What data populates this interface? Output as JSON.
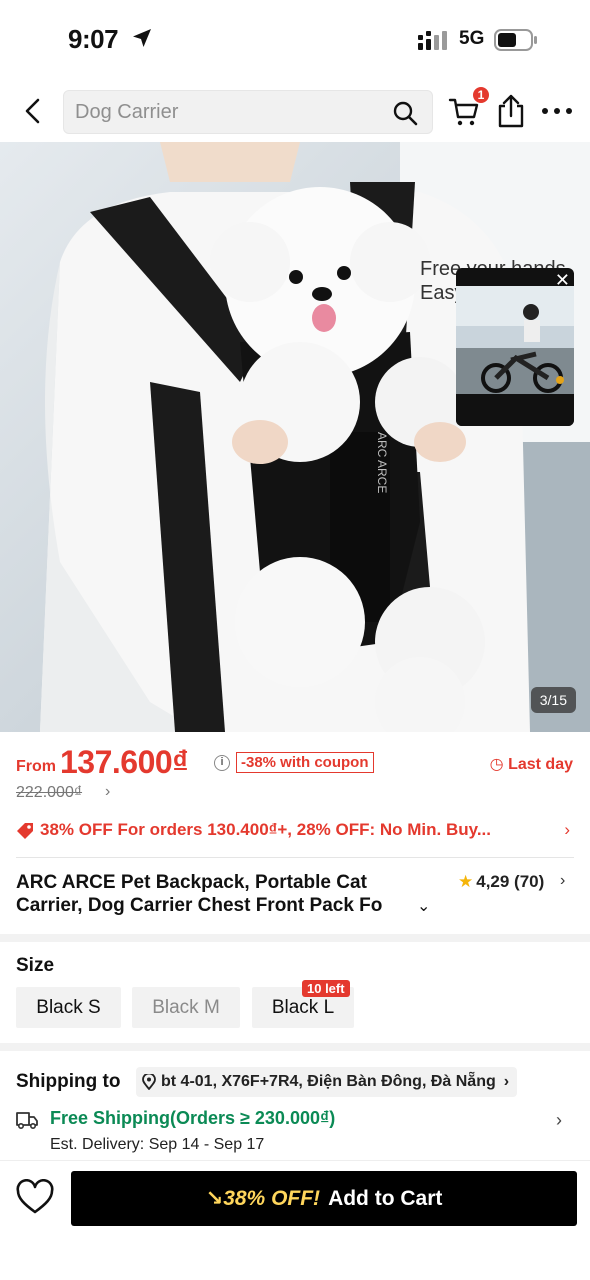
{
  "status_bar": {
    "time": "9:07",
    "network": "5G"
  },
  "header": {
    "search_placeholder": "Dog Carrier",
    "cart_badge": "1"
  },
  "hero": {
    "caption_line1": "Free your hands",
    "caption_line2": "Easy",
    "video_close": "✕",
    "counter": "3/15",
    "bag_brand": "ARC ARCE"
  },
  "price": {
    "from": "From",
    "value": "137.600₫",
    "coupon": "-38% with coupon",
    "last_day": "Last day",
    "original": "222.000₫"
  },
  "promo": {
    "text": "38% OFF For orders 130.400₫+,  28% OFF: No Min. Buy..."
  },
  "product": {
    "title_line1": "ARC ARCE Pet Backpack, Portable Cat",
    "title_line2": "Carrier, Dog Carrier Chest Front Pack Fo",
    "rating": "4,29 (70)"
  },
  "size": {
    "label": "Size",
    "options": [
      {
        "label": "Black S",
        "available": true
      },
      {
        "label": "Black M",
        "available": false
      },
      {
        "label": "Black L",
        "available": true,
        "badge": "10 left"
      }
    ]
  },
  "shipping": {
    "label": "Shipping to",
    "address": "bt 4-01, X76F+7R4, Điện Bàn Đông, Đà Nẵng",
    "free_shipping": "Free Shipping(Orders ≥ 230.000₫)",
    "est_delivery": "Est. Delivery: Sep 14 - Sep 17"
  },
  "bottom_bar": {
    "discount": "38% OFF!",
    "add_to_cart": "Add to Cart"
  },
  "colors": {
    "accent_red": "#e4392e",
    "free_ship_green": "#0b8a55",
    "cta_black": "#000000"
  },
  "icons": [
    "location-arrow-icon",
    "signal-icon",
    "battery-icon",
    "back-icon",
    "search-icon",
    "cart-icon",
    "share-icon",
    "more-icon",
    "info-icon",
    "clock-icon",
    "chevron-right-icon",
    "coupon-tag-icon",
    "star-icon",
    "chevron-down-icon",
    "pin-icon",
    "truck-icon",
    "heart-icon",
    "trend-down-icon",
    "close-icon"
  ]
}
